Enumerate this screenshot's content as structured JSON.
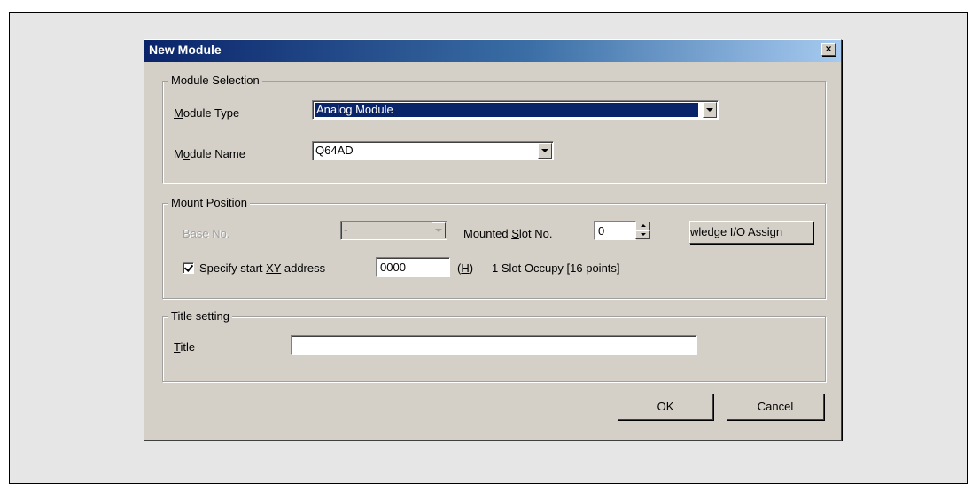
{
  "dialog": {
    "title": "New Module",
    "close_icon": "close-icon",
    "close_glyph": "×"
  },
  "module_selection": {
    "legend": "Module Selection",
    "type_label_pre": "",
    "type_label_u": "M",
    "type_label_post": "odule Type",
    "type_value": "Analog Module",
    "name_label_pre": "M",
    "name_label_u": "o",
    "name_label_post": "dule Name",
    "name_value": "Q64AD"
  },
  "mount_position": {
    "legend": "Mount Position",
    "base_label": "Base No.",
    "base_value": "-",
    "slot_label_pre": "Mounted ",
    "slot_label_u": "S",
    "slot_label_post": "lot No.",
    "slot_value": "0",
    "ack_button": "wledge I/O Assign",
    "specify_checked": true,
    "specify_label_pre": "Specify start ",
    "specify_label_u": "XY",
    "specify_label_post": " address",
    "address_value": "0000",
    "hex_pre": "(",
    "hex_u": "H",
    "hex_post": ")",
    "occupy_text": "1 Slot Occupy [16 points]"
  },
  "title_setting": {
    "legend": "Title setting",
    "title_label_u": "T",
    "title_label_post": "itle",
    "title_value": ""
  },
  "buttons": {
    "ok": "OK",
    "cancel": "Cancel"
  }
}
